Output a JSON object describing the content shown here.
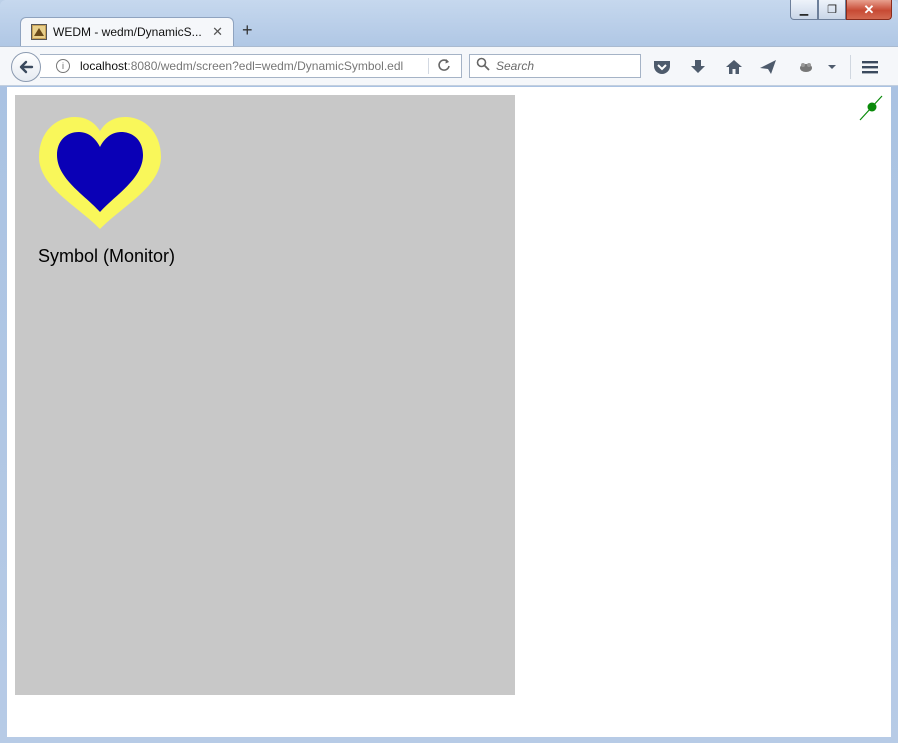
{
  "browser": {
    "tab": {
      "title": "WEDM - wedm/DynamicS...",
      "close_label": "✕"
    },
    "new_tab_label": "+",
    "url": {
      "host": "localhost",
      "rest": ":8080/wedm/screen?edl=wedm/DynamicSymbol.edl"
    },
    "search": {
      "placeholder": "Search"
    },
    "window_controls": {
      "minimize": "▁",
      "maximize": "❐",
      "close": "✕"
    }
  },
  "page": {
    "symbol": {
      "label": "Symbol (Monitor)",
      "outer_color": "#f9f75a",
      "inner_color": "#0a00b6"
    },
    "panel_color": "#c8c8c8",
    "status_indicator_color": "#0a8a0a"
  }
}
